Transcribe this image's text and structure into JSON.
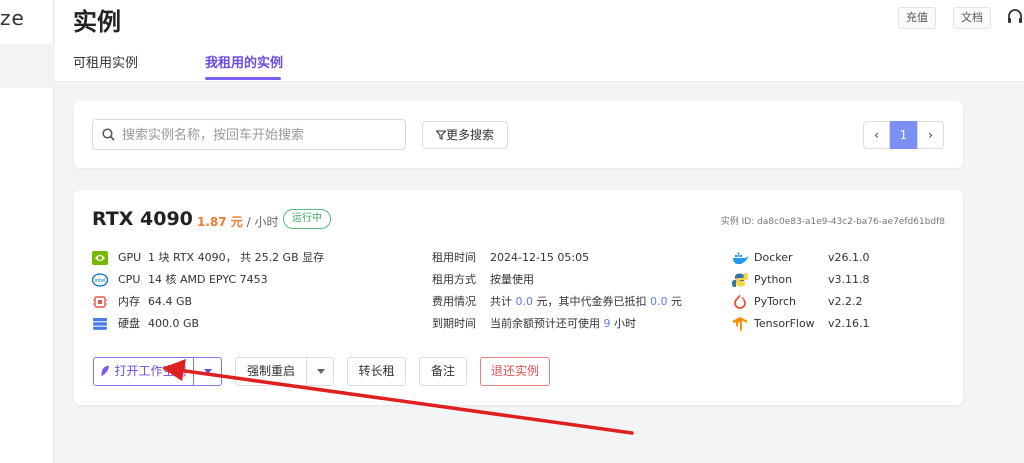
{
  "sidebar": {
    "logo_text": "ze"
  },
  "header": {
    "title": "实例",
    "recharge_label": "充值",
    "docs_label": "文档",
    "tabs": [
      {
        "label": "可租用实例",
        "active": false
      },
      {
        "label": "我租用的实例",
        "active": true
      }
    ]
  },
  "search": {
    "placeholder": "搜索实例名称，按回车开始搜索",
    "value": "",
    "more_label": "更多搜索"
  },
  "pagination": {
    "prev": "‹",
    "current": "1",
    "next": "›"
  },
  "instance": {
    "gpu_model": "RTX 4090",
    "price_value": "1.87 元",
    "price_unit": " / 小时",
    "status": "运行中",
    "instance_id": "实例 ID: da8c0e83-a1e9-43c2-ba76-ae7efd61bdf8",
    "specs": [
      {
        "icon": "nvidia-icon",
        "key": "GPU",
        "value": "1 块 RTX 4090， 共 25.2 GB 显存"
      },
      {
        "icon": "intel-icon",
        "key": "CPU",
        "value": "14 核 AMD EPYC 7453"
      },
      {
        "icon": "memory-chip-icon",
        "key": "内存",
        "value": "64.4 GB"
      },
      {
        "icon": "disk-icon",
        "key": "硬盘",
        "value": "400.0 GB"
      }
    ],
    "rental": {
      "rent_time_label": "租用时间",
      "rent_time_value": "2024-12-15 05:05",
      "rent_mode_label": "租用方式",
      "rent_mode_value": "按量使用",
      "cost_label": "费用情况",
      "cost_prefix": "共计 ",
      "cost_total": "0.0",
      "cost_mid": " 元，其中代金券已抵扣 ",
      "cost_voucher": "0.0",
      "cost_suffix": " 元",
      "expire_label": "到期时间",
      "expire_prefix": "当前余额预计还可使用 ",
      "expire_hours": "9",
      "expire_suffix": " 小时"
    },
    "software": [
      {
        "icon": "docker-icon",
        "name": "Docker",
        "version": "v26.1.0"
      },
      {
        "icon": "python-icon",
        "name": "Python",
        "version": "v3.11.8"
      },
      {
        "icon": "pytorch-icon",
        "name": "PyTorch",
        "version": "v2.2.2"
      },
      {
        "icon": "tensorflow-icon",
        "name": "TensorFlow",
        "version": "v2.16.1"
      }
    ],
    "actions": {
      "open_workspace": "打开工作空间",
      "force_restart": "强制重启",
      "convert_long_term": "转长租",
      "note": "备注",
      "return_instance": "退还实例"
    }
  },
  "colors": {
    "accent": "#7b5cf5",
    "price": "#f07a35",
    "status": "#3aa863",
    "danger": "#e05252",
    "annotation_arrow": "#e02020"
  }
}
